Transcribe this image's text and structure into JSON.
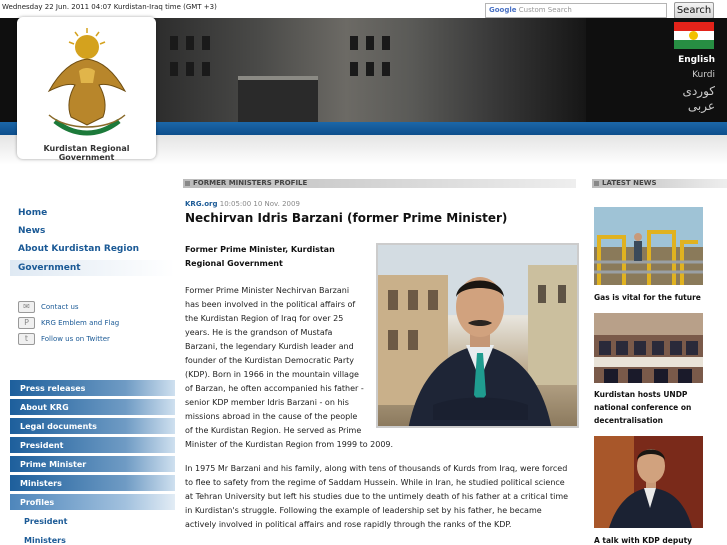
{
  "topbar": {
    "datetime": "Wednesday 22 Jun. 2011  04:07 Kurdistan-Iraq time (GMT +3)",
    "search_brand": "Google",
    "search_placeholder": "Custom Search",
    "search_button": "Search"
  },
  "languages": [
    "English",
    "Kurdi",
    "کوردی",
    "عربی"
  ],
  "logo": {
    "caption": "Kurdistan Regional Government"
  },
  "colors": {
    "accent_blue": "#1b5a96",
    "stripe_blue": "#0d4e8c",
    "flag": [
      "#e2231a",
      "#ffffff",
      "#278e43"
    ],
    "sun": "#f2c100"
  },
  "nav": {
    "top": [
      "Home",
      "News",
      "About Kurdistan Region",
      "Government"
    ],
    "active": "Government",
    "utilities": [
      {
        "label": "Contact us",
        "icon": "envelope-icon"
      },
      {
        "label": "KRG Emblem and Flag",
        "icon": "emblem-icon"
      },
      {
        "label": "Follow us on Twitter",
        "icon": "twitter-icon"
      }
    ],
    "sub": [
      "Press releases",
      "About KRG",
      "Legal documents",
      "President",
      "Prime Minister",
      "Ministers",
      "Profiles"
    ],
    "sub_children": [
      "President",
      "Ministers"
    ]
  },
  "main": {
    "section_title": "FORMER MINISTERS PROFILE",
    "source": "KRG.org",
    "timestamp": "10:05:00 10 Nov. 2009",
    "title": "Nechirvan Idris Barzani (former Prime Minister)",
    "subtitle": "Former Prime Minister, Kurdistan Regional Government",
    "paragraph1_lines": [
      "Former Prime Minister Nechirvan Barzani",
      "has been involved in the political affairs of",
      "the Kurdistan Region of Iraq for over 25",
      "years. He is the grandson of Mustafa",
      "Barzani, the legendary Kurdish leader and",
      "founder of the Kurdistan Democratic Party",
      "(KDP). Born in 1966 in the mountain village",
      "of Barzan, he often accompanied his father -",
      "senior KDP member Idris Barzani - on his",
      "missions abroad in the cause of the people",
      "of the Kurdistan Region. He served as Prime",
      "Minister of the Kurdistan Region from 1999 to 2009."
    ],
    "paragraph2_lines": [
      "In 1975 Mr Barzani and his family, along with tens of thousands of Kurds from Iraq, were forced",
      "to flee to safety from the regime of Saddam Hussein. While in Iran, he studied political science",
      "at Tehran University but left his studies due to the untimely death of his father at a critical time",
      "in Kurdistan's struggle. Following the example of leadership set by his father, he became",
      "actively involved in political affairs and rose rapidly through the ranks of the KDP."
    ]
  },
  "latest_news": {
    "title": "LATEST NEWS",
    "items": [
      {
        "lines": [
          "Gas is vital for the future"
        ]
      },
      {
        "lines": [
          "Kurdistan hosts UNDP",
          "national conference on",
          "decentralisation"
        ]
      },
      {
        "lines": [
          "A talk with KDP deputy"
        ]
      }
    ]
  }
}
